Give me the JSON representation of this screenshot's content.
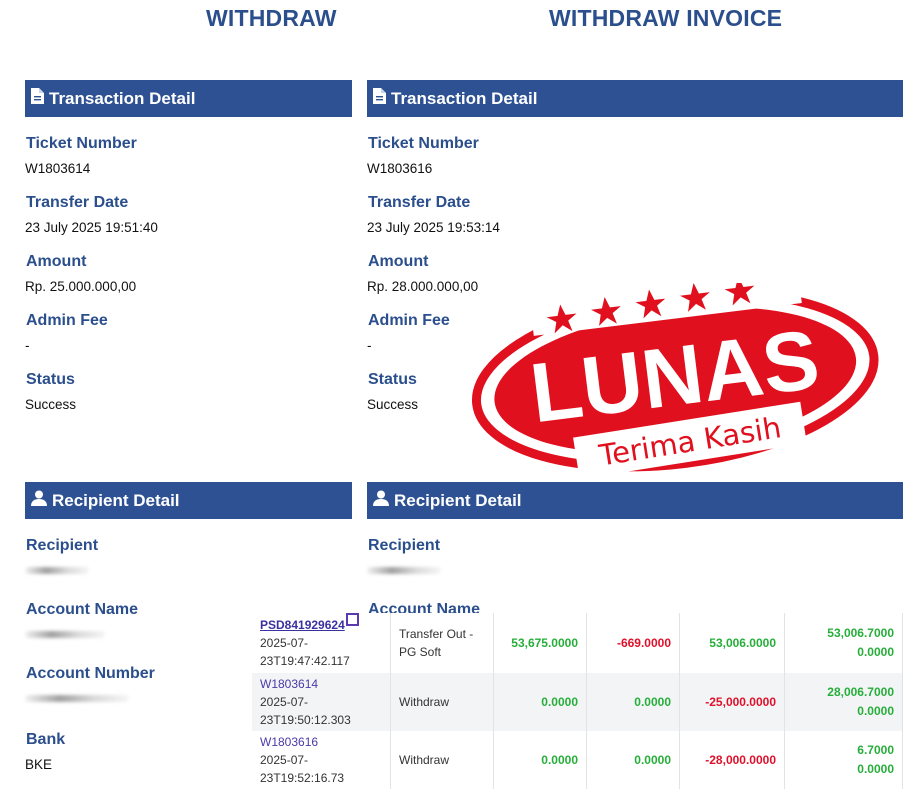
{
  "page": {
    "left_title": "WITHDRAW",
    "right_title": "WITHDRAW INVOICE"
  },
  "left": {
    "transaction_header": "Transaction Detail",
    "ticket_label": "Ticket Number",
    "ticket_value": "W1803614",
    "date_label": "Transfer Date",
    "date_value": "23 July 2025 19:51:40",
    "amount_label": "Amount",
    "amount_value": "Rp. 25.000.000,00",
    "fee_label": "Admin Fee",
    "fee_value": "-",
    "status_label": "Status",
    "status_value": "Success",
    "recipient_header": "Recipient Detail",
    "recipient_label": "Recipient",
    "account_name_label": "Account Name",
    "account_number_label": "Account Number",
    "bank_label": "Bank",
    "bank_value": "BKE"
  },
  "right": {
    "transaction_header": "Transaction Detail",
    "ticket_label": "Ticket Number",
    "ticket_value": "W1803616",
    "date_label": "Transfer Date",
    "date_value": "23 July 2025 19:53:14",
    "amount_label": "Amount",
    "amount_value": "Rp. 28.000.000,00",
    "fee_label": "Admin Fee",
    "fee_value": "-",
    "status_label": "Status",
    "status_value": "Success",
    "recipient_header": "Recipient Detail",
    "recipient_label": "Recipient",
    "account_name_label": "Account Name"
  },
  "stamp": {
    "main_text": "LUNAS",
    "sub_text": "Terima Kasih",
    "color": "#e0101e"
  },
  "transactions": [
    {
      "id": "PSD841929624",
      "time_line1": "2025-07-",
      "time_line2": "23T19:47:42.117",
      "description_line1": "Transfer Out -",
      "description_line2": "PG Soft",
      "col1": "53,675.0000",
      "col2": "-669.0000",
      "col3": "53,006.0000",
      "balance1": "53,006.7000",
      "balance2": "0.0000"
    },
    {
      "id": "W1803614",
      "time_line1": "2025-07-",
      "time_line2": "23T19:50:12.303",
      "description_line1": "Withdraw",
      "description_line2": "",
      "col1": "0.0000",
      "col2": "0.0000",
      "col3": "-25,000.0000",
      "balance1": "28,006.7000",
      "balance2": "0.0000"
    },
    {
      "id": "W1803616",
      "time_line1": "2025-07-",
      "time_line2": "23T19:52:16.73",
      "description_line1": "Withdraw",
      "description_line2": "",
      "col1": "0.0000",
      "col2": "0.0000",
      "col3": "-28,000.0000",
      "balance1": "6.7000",
      "balance2": "0.0000"
    }
  ],
  "colors": {
    "header_bar": "#2d5192",
    "label": "#2b4f8c",
    "positive": "#27ae3a",
    "negative": "#e0102a"
  }
}
